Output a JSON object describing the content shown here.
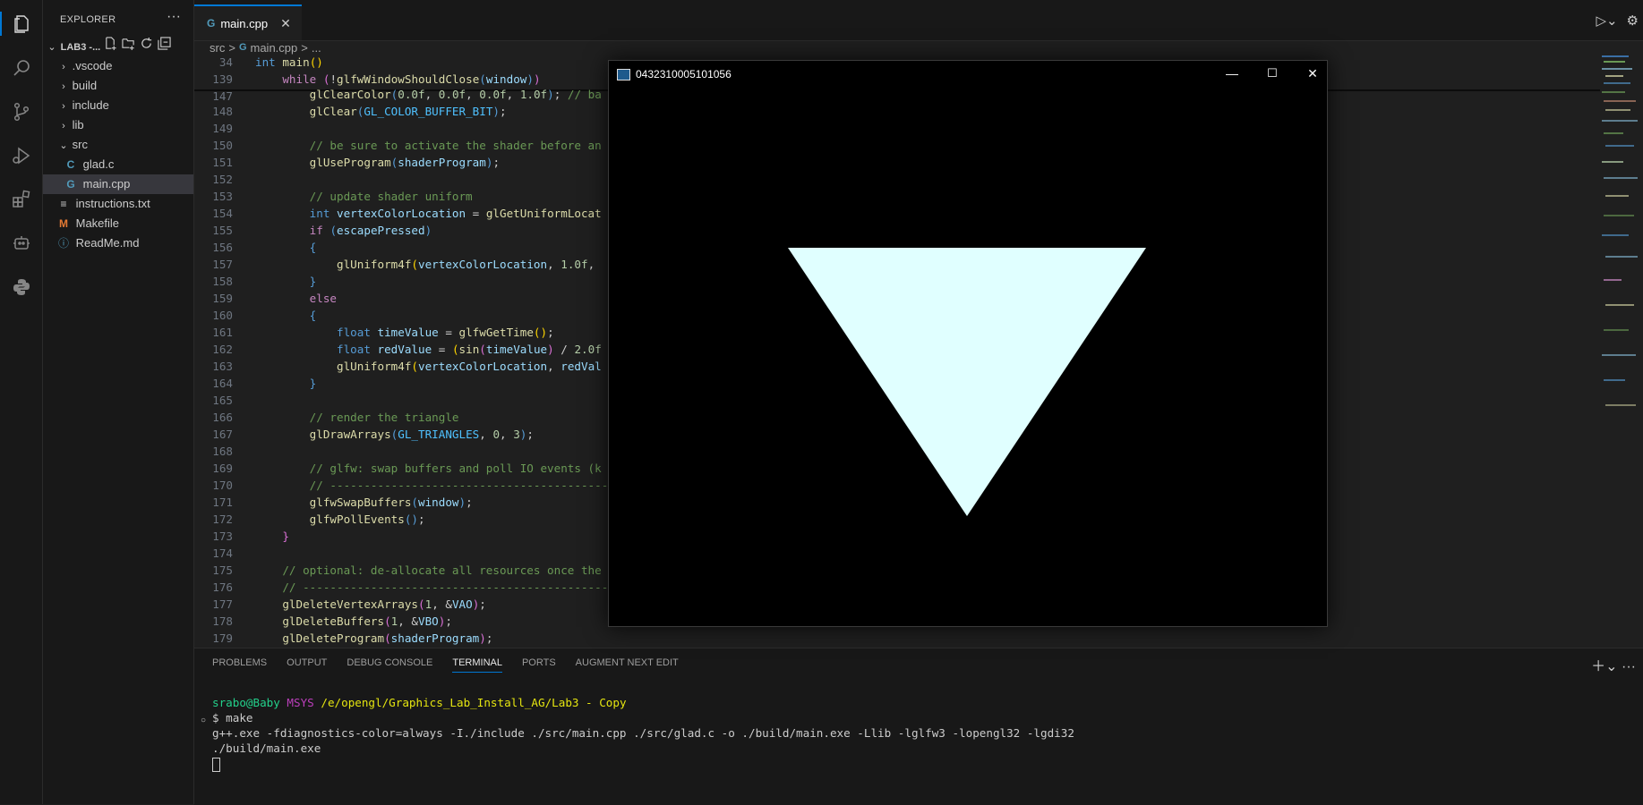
{
  "activity_bar": {
    "items": [
      "files-icon",
      "search-icon",
      "source-control-icon",
      "run-debug-icon",
      "extensions-icon",
      "remote-icon",
      "python-icon"
    ]
  },
  "sidebar": {
    "title": "EXPLORER",
    "more": "···",
    "project": "LAB3 -...",
    "tree": [
      {
        "label": ".vscode",
        "type": "folder",
        "chevron": "›"
      },
      {
        "label": "build",
        "type": "folder",
        "chevron": "›"
      },
      {
        "label": "include",
        "type": "folder",
        "chevron": "›"
      },
      {
        "label": "lib",
        "type": "folder",
        "chevron": "›"
      },
      {
        "label": "src",
        "type": "folder-open",
        "chevron": "⌄"
      },
      {
        "label": "glad.c",
        "type": "c-file",
        "icon": "C"
      },
      {
        "label": "main.cpp",
        "type": "cpp-file",
        "icon": "G"
      },
      {
        "label": "instructions.txt",
        "type": "txt-file",
        "icon": "≡"
      },
      {
        "label": "Makefile",
        "type": "makefile",
        "icon": "M"
      },
      {
        "label": "ReadMe.md",
        "type": "md-file",
        "icon": "ⓘ"
      }
    ]
  },
  "tabs": [
    {
      "label": "main.cpp",
      "icon": "G",
      "close": "✕"
    }
  ],
  "breadcrumb": {
    "folder": "src",
    "sep": ">",
    "file": "main.cpp",
    "rest": "..."
  },
  "colors": {
    "accent": "#0078d4",
    "triangle": "#e0ffff"
  },
  "gl_window": {
    "title": "0432310005101056",
    "minimize": "—",
    "maximize": "☐",
    "close": "✕"
  },
  "panel": {
    "tabs": [
      "PROBLEMS",
      "OUTPUT",
      "DEBUG CONSOLE",
      "TERMINAL",
      "PORTS",
      "AUGMENT NEXT EDIT"
    ],
    "active_tab": "TERMINAL",
    "terminal": {
      "user": "srabo@Baby",
      "host": "MSYS",
      "path": "/e/opengl/Graphics_Lab_Install_AG/Lab3 - Copy",
      "prompt": "$ make",
      "line1": "g++.exe -fdiagnostics-color=always -I./include ./src/main.cpp ./src/glad.c -o ./build/main.exe -Llib -lglfw3 -lopengl32 -lgdi32",
      "line2": "./build/main.exe"
    }
  }
}
